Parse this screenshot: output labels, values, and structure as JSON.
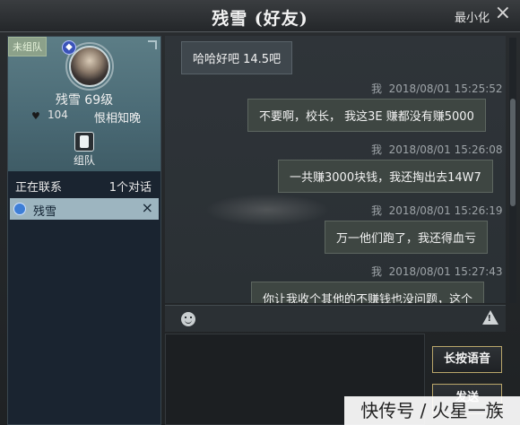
{
  "window": {
    "title": "残雪 (好友)",
    "minimize_label": "最小化",
    "close_label": "×"
  },
  "profile": {
    "team_status": "未组队",
    "school_glyph": "◆",
    "name_level": "残雪  69级",
    "friendship_value": "104",
    "relation": "恨相知晚",
    "team_button_label": "组队"
  },
  "contacts": {
    "title": "正在联系",
    "count": "1个对话",
    "items": [
      {
        "name": "残雪",
        "close": "×"
      }
    ]
  },
  "messages": [
    {
      "side": "left",
      "text": "哈哈好吧  14.5吧"
    },
    {
      "side": "right",
      "sender": "我",
      "time": "2018/08/01  15:25:52",
      "text": "不要啊，校长，  我这3E  赚都没有赚5000"
    },
    {
      "side": "right",
      "sender": "我",
      "time": "2018/08/01  15:26:08",
      "text": "一共赚3000块钱，我还掏出去14W7"
    },
    {
      "side": "right",
      "sender": "我",
      "time": "2018/08/01  15:26:19",
      "text": "万一他们跑了，我还得血亏"
    },
    {
      "side": "right",
      "sender": "我",
      "time": "2018/08/01  15:27:43",
      "text": "你让我收个其他的不赚钱也没问题，这个"
    }
  ],
  "toolbar": {
    "emoji_icon": "smiley-icon",
    "report_icon": "warning-icon",
    "report_mark": "!"
  },
  "buttons": {
    "voice_label": "长按语音",
    "send_label": "发送"
  },
  "watermark": "快传号 / 火星一族"
}
